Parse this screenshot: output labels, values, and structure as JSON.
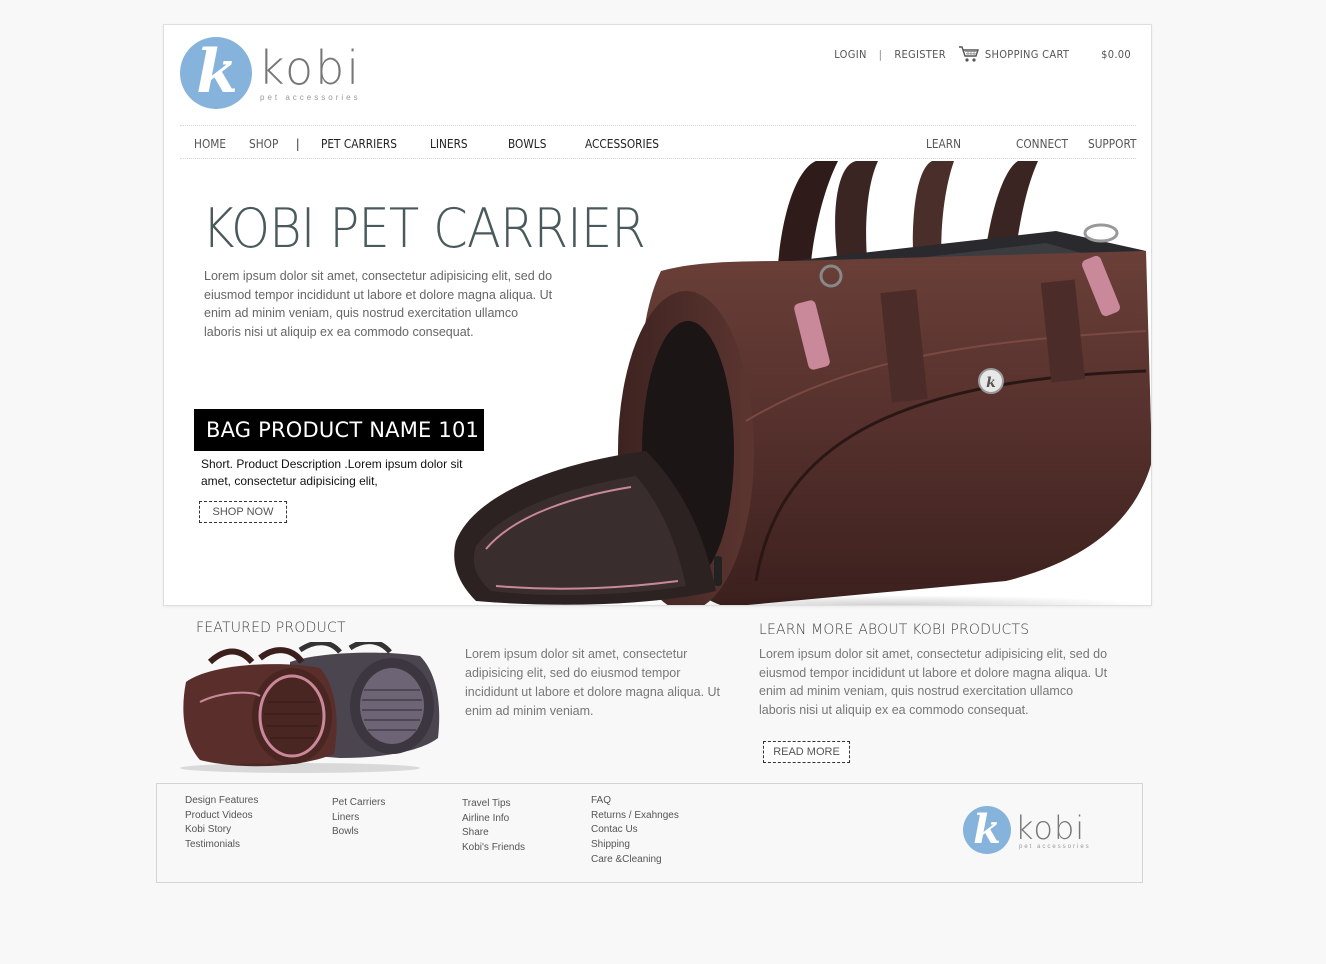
{
  "brand": {
    "name": "kobi",
    "tagline": "pet accessories",
    "logo_color": "#86b3dc"
  },
  "topbar": {
    "login": "LOGIN",
    "separator": "|",
    "register": "REGISTER",
    "cart_icon": "shopping-cart-icon",
    "cart_label": "SHOPPING CART",
    "cart_total": "$0.00"
  },
  "nav": {
    "home": "HOME",
    "shop": "SHOP",
    "separator": "|",
    "pet_carriers": "PET CARRIERS",
    "liners": "LINERS",
    "bowls": "BOWLS",
    "accessories": "ACCESSORIES",
    "learn": "LEARN",
    "connect": "CONNECT",
    "support": "SUPPORT"
  },
  "hero": {
    "title": "KOBI PET CARRIER",
    "text": "Lorem ipsum dolor sit amet, consectetur adipisicing elit, sed do eiusmod tempor incididunt ut labore et dolore magna aliqua. Ut enim ad minim veniam, quis nostrud exercitation ullamco laboris nisi ut aliquip ex ea commodo consequat.",
    "product_name": "BAG PRODUCT NAME  101",
    "product_description": "Short. Product Description .Lorem ipsum dolor sit amet, consectetur adipisicing elit,",
    "shop_now": "SHOP NOW"
  },
  "featured": {
    "title": "FEATURED PRODUCT",
    "text": "Lorem ipsum dolor sit amet, consectetur adipisicing elit, sed do eiusmod tempor incididunt ut labore et dolore magna aliqua. Ut enim ad minim veniam."
  },
  "learn_more": {
    "title": "LEARN MORE ABOUT KOBI PRODUCTS",
    "text": "Lorem ipsum dolor sit amet, consectetur adipisicing elit, sed do eiusmod tempor incididunt ut labore et dolore magna aliqua. Ut enim ad minim veniam, quis nostrud exercitation ullamco laboris nisi ut aliquip ex ea commodo consequat.",
    "read_more": "READ MORE"
  },
  "footer": {
    "col1": [
      "Design Features",
      "Product Videos",
      "Kobi Story",
      "Testimonials"
    ],
    "col2": [
      "Pet Carriers",
      "Liners",
      "Bowls"
    ],
    "col3": [
      "Travel Tips",
      "Airline Info",
      "Share",
      "Kobi's Friends"
    ],
    "col4": [
      "FAQ",
      "Returns / Exahnges",
      "Contac Us",
      "Shipping",
      "Care &Cleaning"
    ]
  }
}
